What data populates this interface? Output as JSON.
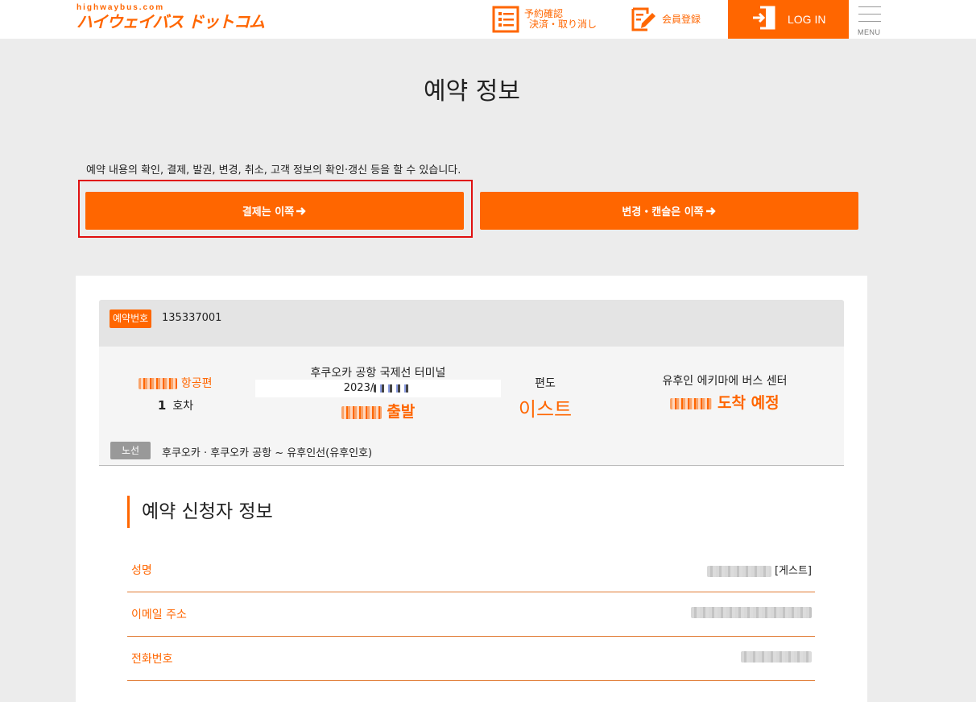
{
  "header": {
    "logo_small": "highwaybus.com",
    "logo_main": "ハイウェイバス ドットコム",
    "reservation_link_line1": "予約確認",
    "reservation_link_line2": "決済・取り消し",
    "member_link": "会員登録",
    "login_label": "LOG IN",
    "menu_label": "MENU",
    "icons": [
      "list-icon",
      "edit-icon",
      "login-icon",
      "hamburger-icon"
    ],
    "accent_color": "#ff6600"
  },
  "page": {
    "title": "예약 정보",
    "intro": "예약 내용의 확인, 결제, 발권, 변경, 취소, 고객 정보의 확인·갱신 등을 할 수 있습니다.",
    "payment_button": "결제는 이쪽",
    "change_button": "변경・캔슬은 이쪽",
    "arrow_icon": "arrow-right-icon"
  },
  "reservation": {
    "number_label": "예약번호",
    "number": "135337001",
    "flight_suffix": "항공편",
    "car_number": "1",
    "car_label": "호차",
    "departure_stop": "후쿠오카 공항 국제선 터미널",
    "departure_date_prefix": "2023/",
    "departure_suffix": "출발",
    "trip_label": "편도",
    "trip_value": "이스트",
    "arrival_stop": "유후인 에키마에 버스 센터",
    "arrival_suffix": "도착 예정",
    "route_label": "노선",
    "route": "후쿠오카 · 후쿠오카 공항 ~ 유후인선(유후인호)"
  },
  "applicant": {
    "title": "예약 신청자 정보",
    "name_label": "성명",
    "name_suffix": "[게스트]",
    "email_label": "이메일 주소",
    "phone_label": "전화번호"
  }
}
